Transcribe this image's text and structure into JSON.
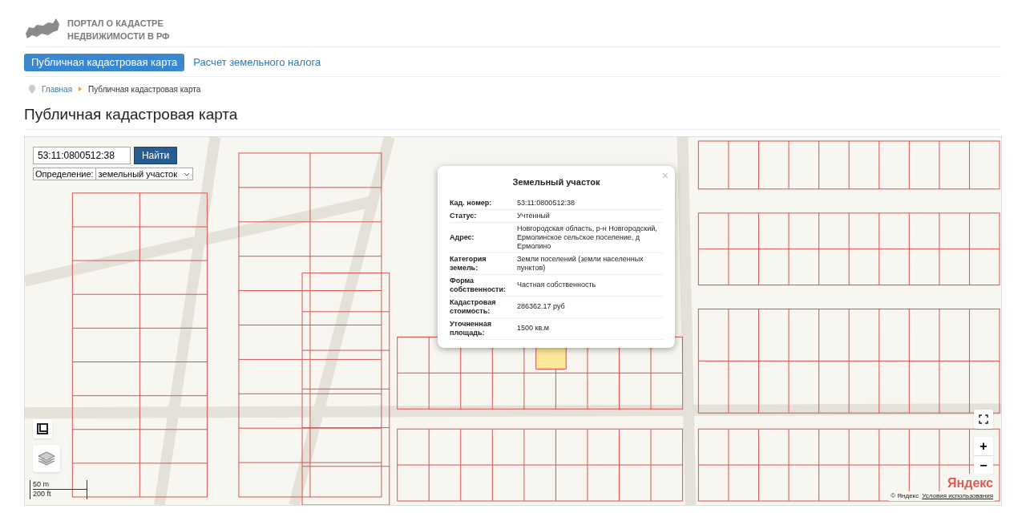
{
  "logo": {
    "line_1": "ПОРТАЛ О КАДАСТРЕ",
    "line_2": "НЕДВИЖИМОСТИ В РФ"
  },
  "nav": [
    {
      "label": "Публичная кадастровая карта",
      "selected": true
    },
    {
      "label": "Расчет земельного налога",
      "selected": false
    }
  ],
  "breadcrumb": [
    "Главная",
    "Публичная кадастровая карта"
  ],
  "page_title": "Публичная кадастровая карта",
  "map": {
    "search": {
      "value": "53:11:0800512:38",
      "button": "Найти"
    },
    "mode": {
      "label": "Определение:",
      "value": "земельный участок"
    },
    "popup": {
      "title": "Земельный участок",
      "close": "×",
      "rows": [
        {
          "label": "Кад. номер:",
          "value": "53:11:0800512:38"
        },
        {
          "label": "Статус:",
          "value": "Учтенный"
        },
        {
          "label": "Адрес:",
          "value": "Новгородская область, р-н Новгородский, Ермолинское сельское поселение, д Ермолино"
        },
        {
          "label": "Категория земель:",
          "value": "Земли поселений (земли населенных пунктов)"
        },
        {
          "label": "Форма собственности:",
          "value": "Частная собственность"
        },
        {
          "label": "Кадастровая стоимость:",
          "value": "286362.17 руб"
        },
        {
          "label": "Уточненная площадь:",
          "value": "1500 кв.м"
        }
      ]
    },
    "zoom_in": "+",
    "zoom_out": "−",
    "scale": [
      "50 m",
      "200 ft"
    ],
    "provider_logo": "Яндекс",
    "copyright": "© Яндекс",
    "terms_link": "Условия использования"
  }
}
